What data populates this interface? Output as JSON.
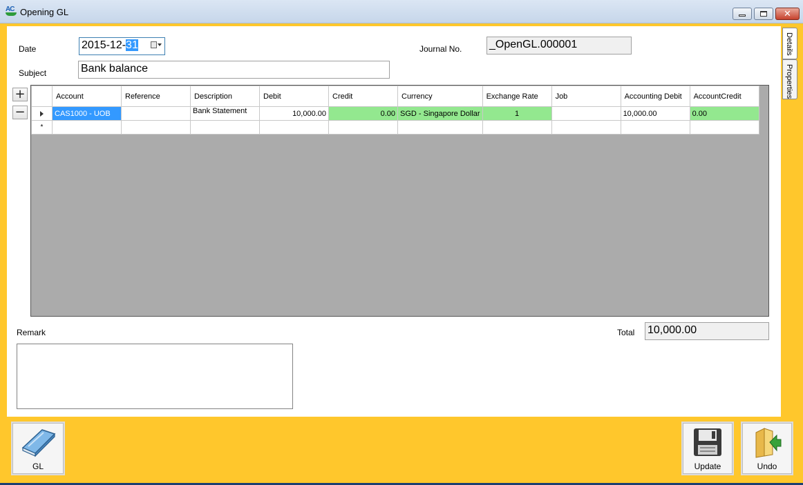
{
  "window": {
    "title": "Opening GL",
    "icon_text": "AC"
  },
  "form": {
    "date_label": "Date",
    "date_value_prefix": "2015-12-",
    "date_value_selected": "31",
    "journal_label": "Journal No.",
    "journal_value": "_OpenGL.000001",
    "subject_label": "Subject",
    "subject_value": "Bank balance",
    "remark_label": "Remark",
    "remark_value": "",
    "total_label": "Total",
    "total_value": "10,000.00"
  },
  "grid": {
    "add_label": "+",
    "remove_label": "−",
    "columns": [
      "Account",
      "Reference",
      "Description",
      "Debit",
      "Credit",
      "Currency",
      "Exchange Rate",
      "Job",
      "Accounting Debit",
      "AccountCredit"
    ],
    "rows": [
      {
        "account": "CAS1000 - UOB",
        "reference": "",
        "description": "Bank Statement",
        "debit": "10,000.00",
        "credit": "0.00",
        "currency": "SGD - Singapore Dollar",
        "exchange_rate": "1",
        "job": "",
        "accounting_debit": "10,000.00",
        "account_credit": "0.00"
      }
    ],
    "new_row_marker": "*"
  },
  "side_tabs": [
    "Details",
    "Properties"
  ],
  "buttons": {
    "gl": "GL",
    "update": "Update",
    "undo": "Undo"
  },
  "colors": {
    "background": "#ffc72c",
    "green_cell": "#93e88f",
    "selection": "#3399ff"
  }
}
